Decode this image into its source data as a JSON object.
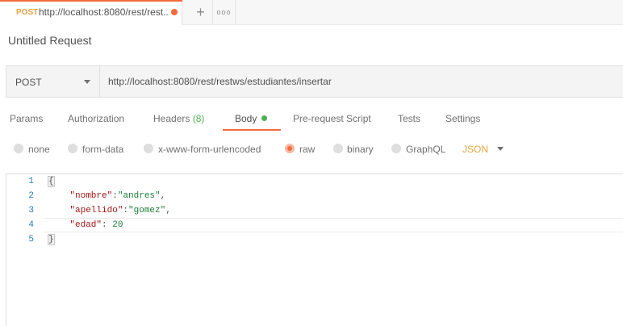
{
  "tab": {
    "method": "POST",
    "title": "http://localhost:8080/rest/rest..."
  },
  "tab_actions": {
    "new_tab": "+",
    "more": "ooo"
  },
  "request_name": "Untitled Request",
  "method": "POST",
  "url": "http://localhost:8080/rest/restws/estudiantes/insertar",
  "request_tabs": {
    "params": "Params",
    "authorization": "Authorization",
    "headers": "Headers",
    "headers_count": "(8)",
    "body": "Body",
    "prerequest": "Pre-request Script",
    "tests": "Tests",
    "settings": "Settings"
  },
  "body_types": {
    "none": "none",
    "form_data": "form-data",
    "urlencoded": "x-www-form-urlencoded",
    "raw": "raw",
    "binary": "binary",
    "graphql": "GraphQL",
    "selected": "raw"
  },
  "language": "JSON",
  "editor": {
    "line_numbers": [
      "1",
      "2",
      "3",
      "4",
      "5"
    ],
    "open_brace": "{",
    "close_brace": "}",
    "line2_key": "\"nombre\"",
    "line2_sep": ":",
    "line2_val": "\"andres\"",
    "line2_end": ",",
    "line3_key": "\"apellido\"",
    "line3_sep": ":",
    "line3_val": "\"gomez\"",
    "line3_end": ",",
    "line4_key": "\"edad\"",
    "line4_sep": ": ",
    "line4_val": "20"
  },
  "colors": {
    "accent": "#f26b3a",
    "method_post": "#e8a33d",
    "active_green": "#4caf50"
  }
}
